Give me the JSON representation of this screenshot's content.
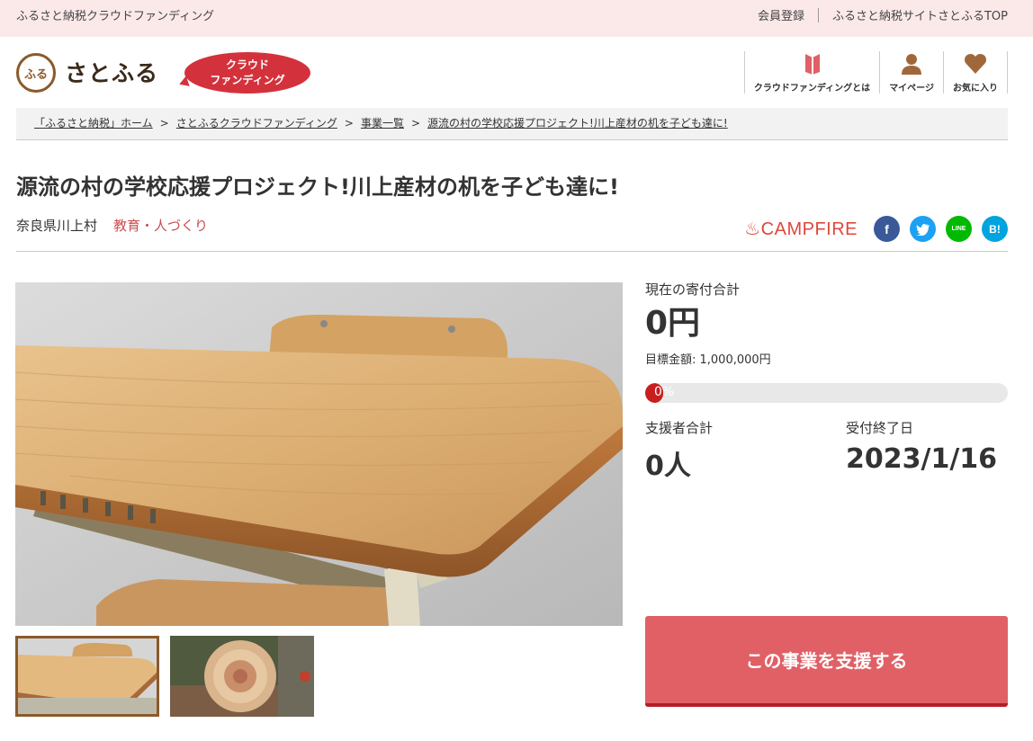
{
  "topbar": {
    "site_name": "ふるさと納税クラウドファンディング",
    "member_link": "会員登録",
    "top_link": "ふるさと納税サイトさとふるTOP"
  },
  "header": {
    "logo_text": "さとふる",
    "cf_badge_line1": "クラウド",
    "cf_badge_line2": "ファンディング",
    "nav": [
      {
        "label": "クラウドファンディングとは",
        "icon": "book-icon"
      },
      {
        "label": "マイページ",
        "icon": "user-icon"
      },
      {
        "label": "お気に入り",
        "icon": "heart-icon"
      }
    ]
  },
  "breadcrumb": [
    "「ふるさと納税」ホーム",
    "さとふるクラウドファンディング",
    "事業一覧",
    "源流の村の学校応援プロジェクト!川上産材の机を子ども達に!"
  ],
  "project": {
    "title": "源流の村の学校応援プロジェクト!川上産材の机を子ども達に!",
    "location": "奈良県川上村",
    "category": "教育・人づくり"
  },
  "share": {
    "campfire_label": "CAMPFIRE",
    "facebook": "f",
    "twitter": "t",
    "line": "LINE",
    "hatena": "B!"
  },
  "stats": {
    "current_label": "現在の寄付合計",
    "current_value": "0円",
    "goal_label": "目標金額: 1,000,000円",
    "progress_percent": 0,
    "progress_text": "0%",
    "supporters_label": "支援者合計",
    "supporters_value": "0人",
    "deadline_label": "受付終了日",
    "deadline_value": "2023/1/16"
  },
  "support_button": "この事業を支援する",
  "colors": {
    "accent": "#e06066",
    "brand_red": "#d3323c",
    "topbar_bg": "#fbe9ea",
    "progress_fill": "#c81e1e"
  }
}
